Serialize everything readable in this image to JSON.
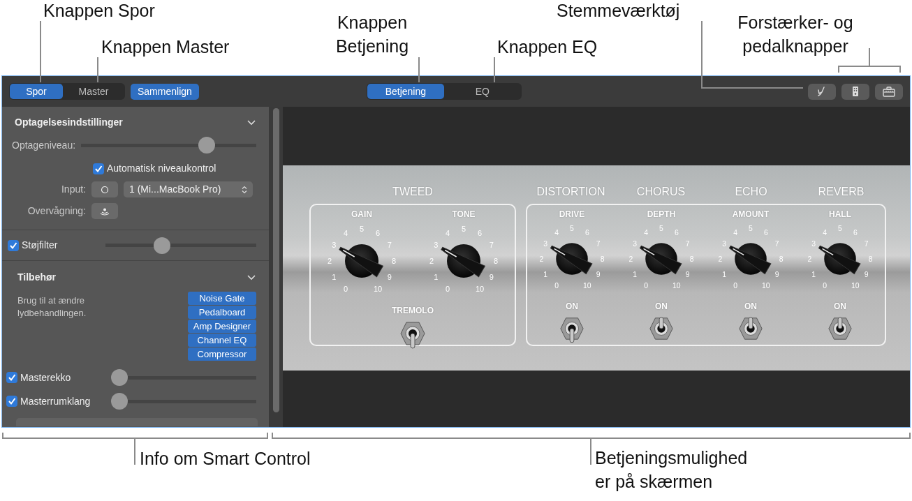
{
  "annotations": [
    {
      "lines": [
        "Knappen Spor"
      ]
    },
    {
      "lines": [
        "Knappen Master"
      ]
    },
    {
      "lines": [
        "Knappen",
        "Betjening"
      ]
    },
    {
      "lines": [
        "Knappen EQ"
      ]
    },
    {
      "lines": [
        "Stemmeværktøj"
      ]
    },
    {
      "lines": [
        "Forstærker- og",
        "pedalknapper"
      ]
    },
    {
      "lines": [
        "Info om Smart Control"
      ]
    },
    {
      "lines": [
        "Betjeningsmulighed",
        "er på skærmen"
      ]
    }
  ],
  "toolbar": {
    "track_tabs": [
      {
        "label": "Spor",
        "selected": true
      },
      {
        "label": "Master",
        "selected": false
      }
    ],
    "compare_button": "Sammenlign",
    "view_tabs": [
      {
        "label": "Betjening",
        "selected": true
      },
      {
        "label": "EQ",
        "selected": false
      }
    ]
  },
  "inspector": {
    "recording": {
      "title": "Optagelsesindstillinger",
      "expanded": true
    },
    "record_level": {
      "label": "Optageniveau:",
      "level": 0.74
    },
    "auto_level": {
      "label": "Automatisk niveaukontrol",
      "checked": true
    },
    "input": {
      "label": "Input:",
      "value": "1 (Mi...MacBook Pro)"
    },
    "monitoring": {
      "label": "Overvågning:"
    },
    "noise_filter": {
      "label": "Støjfilter",
      "checked": true,
      "level": 0.36
    },
    "accessories": {
      "title": "Tilbehør",
      "expanded": true,
      "description": "Brug til at ændre lydbehandlingen.",
      "plugins": [
        "Noise Gate",
        "Pedalboard",
        "Amp Designer",
        "Channel EQ",
        "Compressor"
      ]
    },
    "master_effects": [
      {
        "label": "Masterekko",
        "checked": true,
        "level": 0
      },
      {
        "label": "Masterrumklang",
        "checked": true,
        "level": 0
      }
    ]
  },
  "amp": {
    "sections": [
      {
        "title": "TWEED",
        "knobs": [
          {
            "label": "GAIN",
            "scale": [
              "0",
              "1",
              "2",
              "3",
              "4",
              "5",
              "6",
              "7",
              "8",
              "9",
              "10"
            ]
          },
          {
            "label": "TONE",
            "scale": [
              "0",
              "1",
              "2",
              "3",
              "4",
              "5",
              "6",
              "7",
              "8",
              "9",
              "10"
            ]
          }
        ],
        "switches": [
          {
            "label": "TREMOLO",
            "on": false
          }
        ]
      },
      {
        "title": "DISTORTION",
        "knobs": [
          {
            "label": "DRIVE",
            "scale": [
              "0",
              "1",
              "2",
              "3",
              "4",
              "5",
              "6",
              "7",
              "8",
              "9",
              "10"
            ]
          }
        ],
        "switches": [
          {
            "label": "ON",
            "on": false
          }
        ]
      },
      {
        "title": "CHORUS",
        "knobs": [
          {
            "label": "DEPTH",
            "scale": [
              "0",
              "1",
              "2",
              "3",
              "4",
              "5",
              "6",
              "7",
              "8",
              "9",
              "10"
            ]
          }
        ],
        "switches": [
          {
            "label": "ON",
            "on": true
          }
        ]
      },
      {
        "title": "ECHO",
        "knobs": [
          {
            "label": "AMOUNT",
            "scale": [
              "0",
              "1",
              "2",
              "3",
              "4",
              "5",
              "6",
              "7",
              "8",
              "9",
              "10"
            ]
          }
        ],
        "switches": [
          {
            "label": "ON",
            "on": true
          }
        ]
      },
      {
        "title": "REVERB",
        "knobs": [
          {
            "label": "HALL",
            "scale": [
              "0",
              "1",
              "2",
              "3",
              "4",
              "5",
              "6",
              "7",
              "8",
              "9",
              "10"
            ]
          }
        ],
        "switches": [
          {
            "label": "ON",
            "on": true
          }
        ]
      }
    ]
  }
}
